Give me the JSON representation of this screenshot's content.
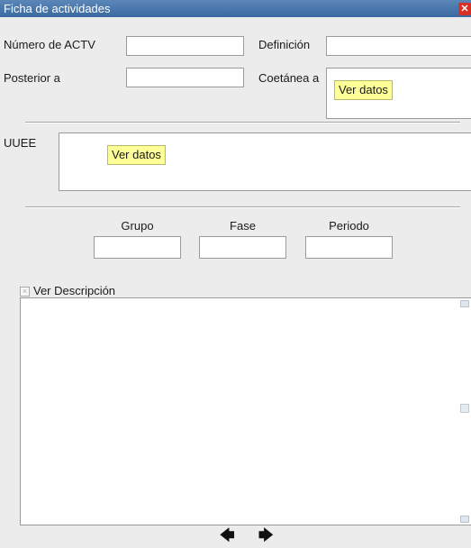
{
  "window": {
    "title": "Ficha de actividades",
    "close_glyph": "✕"
  },
  "fields": {
    "numero_actv": {
      "label": "Número de ACTV",
      "value": ""
    },
    "definicion": {
      "label": "Definición",
      "value": ""
    },
    "posterior_a": {
      "label": "Posterior a",
      "value": ""
    },
    "coetanea_a": {
      "label": "Coetánea a",
      "button": "Ver datos"
    }
  },
  "uuee": {
    "label": "UUEE",
    "button": "Ver datos"
  },
  "phase": {
    "grupo": {
      "label": "Grupo",
      "value": ""
    },
    "fase": {
      "label": "Fase",
      "value": ""
    },
    "periodo": {
      "label": "Periodo",
      "value": ""
    }
  },
  "descripcion": {
    "checkbox_label": "Ver Descripción",
    "checked": false,
    "text": ""
  },
  "navigation": {
    "prev_glyph": "🡄",
    "next_glyph": "🡆"
  },
  "icons": {
    "close": "close-icon",
    "prev": "arrow-left-icon",
    "next": "arrow-right-icon"
  },
  "colors": {
    "titlebar": "#3a6aa0",
    "button_highlight": "#ffff99",
    "close": "#d93025"
  }
}
